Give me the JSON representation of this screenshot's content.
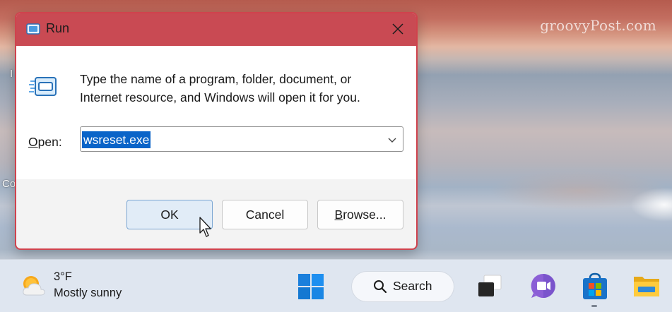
{
  "watermark": "groovyPost.com",
  "desktop_fragments": {
    "top_left": "I",
    "mid_left": "Co"
  },
  "run_dialog": {
    "title": "Run",
    "description": "Type the name of a program, folder, document, or Internet resource, and Windows will open it for you.",
    "open_label_accel": "O",
    "open_label_rest": "pen:",
    "open_value": "wsreset.exe",
    "buttons": {
      "ok": "OK",
      "cancel": "Cancel",
      "browse_accel": "B",
      "browse_rest": "rowse..."
    },
    "accent_color": "#c94a53"
  },
  "taskbar": {
    "weather": {
      "temperature": "3°F",
      "condition": "Mostly sunny"
    },
    "search_label": "Search",
    "pinned_icons": [
      "windows-start-icon",
      "search-icon",
      "task-view-icon",
      "teams-chat-icon",
      "microsoft-store-icon",
      "file-explorer-icon"
    ]
  }
}
